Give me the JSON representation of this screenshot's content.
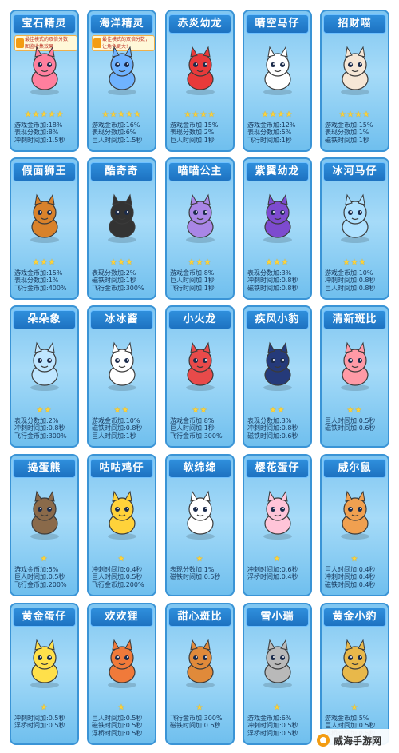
{
  "cards": [
    {
      "name": "宝石精灵",
      "stars": "★★★★★",
      "stats": [
        "游戏金币加:18%",
        "表现分数加:8%",
        "冲刺时间加:1.5秒"
      ],
      "badge": "最佳模式的双倍分数，图鉴收集效果"
    },
    {
      "name": "海洋精灵",
      "stars": "★★★★★",
      "stats": [
        "游戏金币加:16%",
        "表现分数加:6%",
        "巨人时间加:1.5秒"
      ],
      "badge": "最佳模式的双倍分数，让角色更大!"
    },
    {
      "name": "赤炎幼龙",
      "stars": "★★★★",
      "stats": [
        "游戏金币加:15%",
        "表现分数加:2%",
        "巨人时间加:1秒"
      ]
    },
    {
      "name": "晴空马仔",
      "stars": "★★★★",
      "stats": [
        "游戏金币加:12%",
        "表现分数加:5%",
        "飞行时间加:1秒"
      ]
    },
    {
      "name": "招财喵",
      "stars": "★★★★",
      "stats": [
        "游戏金币加:15%",
        "表现分数加:1%",
        "磁铁时间加:1秒"
      ]
    },
    {
      "name": "假面狮王",
      "stars": "★★★",
      "stats": [
        "游戏金币加:15%",
        "表现分数加:1%",
        "飞行金币加:400%"
      ]
    },
    {
      "name": "酷奇奇",
      "stars": "★★★",
      "stats": [
        "表现分数加:2%",
        "磁铁时间加:1秒",
        "飞行金币加:300%"
      ]
    },
    {
      "name": "喵喵公主",
      "stars": "★★★",
      "stats": [
        "游戏金币加:8%",
        "巨人时间加:1秒",
        "飞行时间加:1秒"
      ]
    },
    {
      "name": "紫翼幼龙",
      "stars": "★★★",
      "stats": [
        "表现分数加:3%",
        "冲刺时间加:0.8秒",
        "磁铁时间加:0.8秒"
      ]
    },
    {
      "name": "冰河马仔",
      "stars": "★★★",
      "stats": [
        "游戏金币加:10%",
        "冲刺时间加:0.8秒",
        "巨人时间加:0.8秒"
      ]
    },
    {
      "name": "朵朵象",
      "stars": "★★",
      "stats": [
        "表现分数加:2%",
        "冲刺时间加:0.8秒",
        "飞行金币加:300%"
      ]
    },
    {
      "name": "冰冰酱",
      "stars": "★★",
      "stats": [
        "游戏金币加:10%",
        "磁铁时间加:0.8秒",
        "巨人时间加:1秒"
      ]
    },
    {
      "name": "小火龙",
      "stars": "★★",
      "stats": [
        "游戏金币加:8%",
        "巨人时间加:1秒",
        "飞行金币加:300%"
      ]
    },
    {
      "name": "疾风小豹",
      "stars": "★★",
      "stats": [
        "表现分数加:3%",
        "冲刺时间加:0.8秒",
        "磁铁时间加:0.6秒"
      ]
    },
    {
      "name": "清新斑比",
      "stars": "★★",
      "stats": [
        "巨人时间加:0.5秒",
        "磁铁时间加:0.6秒"
      ]
    },
    {
      "name": "捣蛋熊",
      "stars": "★",
      "stats": [
        "游戏金币加:5%",
        "巨人时间加:0.5秒",
        "飞行金币加:200%"
      ]
    },
    {
      "name": "咕咕鸡仔",
      "stars": "★",
      "stats": [
        "冲刺时间加:0.4秒",
        "巨人时间加:0.5秒",
        "飞行金币加:200%"
      ]
    },
    {
      "name": "软绵绵",
      "stars": "★",
      "stats": [
        "表现分数加:1%",
        "磁铁时间加:0.5秒"
      ]
    },
    {
      "name": "樱花蛋仔",
      "stars": "★",
      "stats": [
        "冲刺时间加:0.6秒",
        "浮桥时间加:0.4秒"
      ]
    },
    {
      "name": "威尔鼠",
      "stars": "★",
      "stats": [
        "巨人时间加:0.4秒",
        "冲刺时间加:0.4秒",
        "磁铁时间加:0.4秒"
      ]
    },
    {
      "name": "黄金蛋仔",
      "stars": "★",
      "stats": [
        "冲刺时间加:0.5秒",
        "浮桥时间加:0.5秒"
      ]
    },
    {
      "name": "欢欢狸",
      "stars": "★",
      "stats": [
        "巨人时间加:0.5秒",
        "磁铁时间加:0.5秒",
        "浮桥时间加:0.5秒"
      ]
    },
    {
      "name": "甜心斑比",
      "stars": "★",
      "stats": [
        "飞行金币加:300%",
        "磁铁时间加:0.6秒"
      ]
    },
    {
      "name": "雪小瑞",
      "stars": "★",
      "stats": [
        "游戏金币加:6%",
        "冲刺时间加:0.5秒",
        "浮桥时间加:0.5秒"
      ]
    },
    {
      "name": "黄金小豹",
      "stars": "★",
      "stats": [
        "游戏金币加:5%",
        "巨人时间加:0.5秒",
        "浮桥时间加:0.5秒"
      ]
    }
  ],
  "watermark": "威海手游网",
  "colors": {
    "card_bg": "#a6dbf8",
    "name_bar": "#1d72c1",
    "star": "#ffd43a",
    "text": "#16365a"
  }
}
